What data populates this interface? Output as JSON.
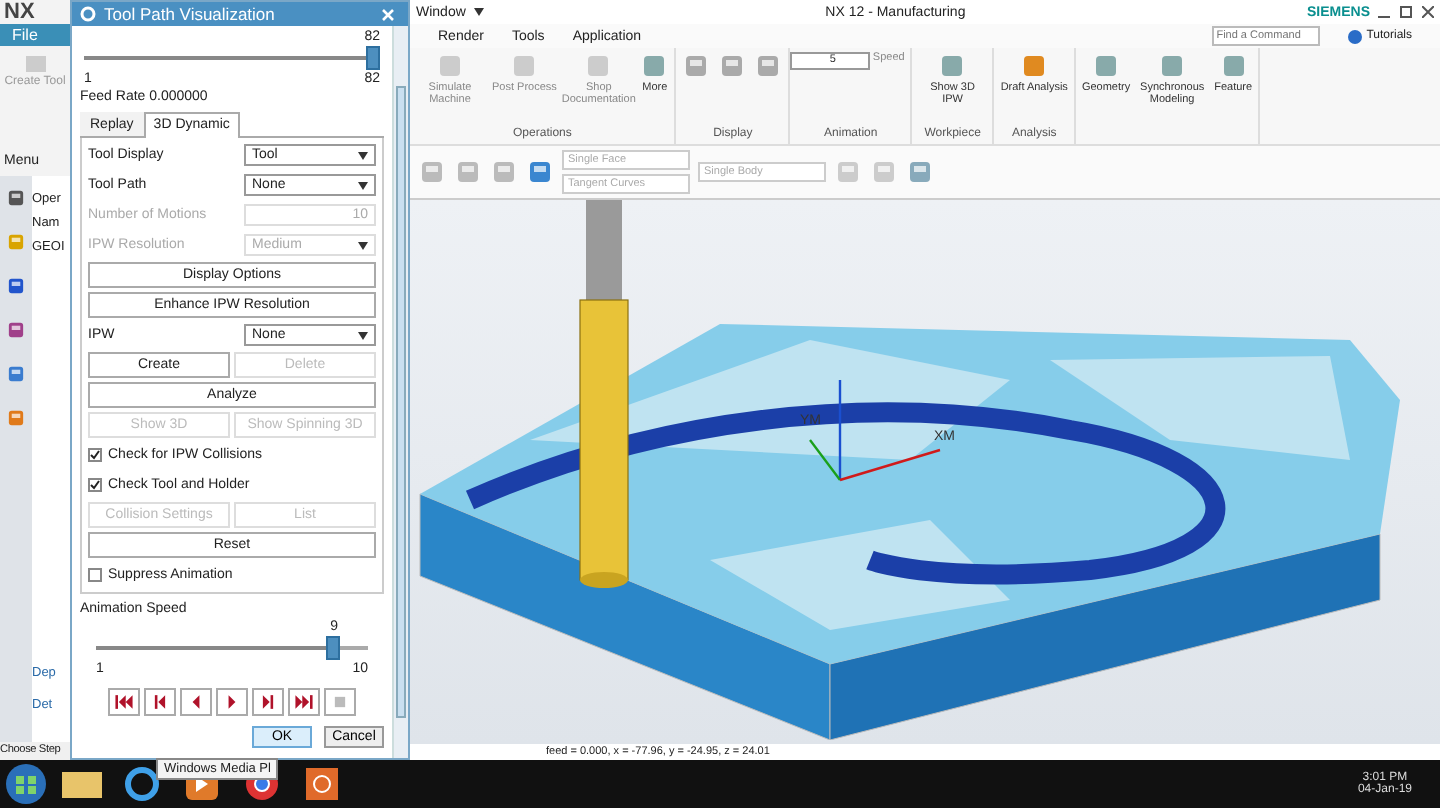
{
  "background_app": {
    "logo": "NX",
    "file_tab": "File",
    "create_button": "Create Tool",
    "menu": "Menu",
    "navigator_header": "Oper",
    "navigator_column": "Nam",
    "navigator_row": "GEOI",
    "detail_rows": [
      "Dep",
      "Det"
    ],
    "status": "Choose Step"
  },
  "main_window": {
    "menu_title": "Window",
    "title": "NX 12 - Manufacturing",
    "brand": "SIEMENS",
    "tabs": [
      {
        "label": "Render"
      },
      {
        "label": "Tools"
      },
      {
        "label": "Application"
      }
    ],
    "search": {
      "placeholder": "Find a Command"
    },
    "help": "Tutorials",
    "ribbon_groups": [
      {
        "label": "Operations",
        "buttons": [
          "Simulate Machine",
          "Post Process",
          "Shop Documentation",
          "More"
        ]
      },
      {
        "label": "Display"
      },
      {
        "label": "Animation",
        "buttons": [
          "Speed"
        ],
        "speed_value": "5"
      },
      {
        "label": "Workpiece",
        "buttons": [
          "Show 3D IPW"
        ]
      },
      {
        "label": "Analysis",
        "buttons": [
          "Draft Analysis"
        ]
      },
      {
        "buttons": [
          "Geometry",
          "Synchronous Modeling",
          "Feature"
        ]
      }
    ],
    "selection_filters": [
      "Single Face",
      "Single Body",
      "Tangent Curves"
    ],
    "viewport": {
      "axis_labels": [
        "YM",
        "XM"
      ]
    },
    "status_bar": "feed = 0.000, x = -77.96, y = -24.95, z = 24.01"
  },
  "dialog": {
    "title": "Tool Path Visualization",
    "motion_slider": {
      "max_label": "82",
      "value": "82",
      "min_label": "1",
      "level": 1
    },
    "feed_rate": "Feed Rate 0.000000",
    "tabs": [
      {
        "label": "Replay",
        "selected": false
      },
      {
        "label": "3D Dynamic",
        "selected": true
      }
    ],
    "rows": [
      {
        "kind": "dropdown",
        "label": "Tool Display",
        "value": "Tool",
        "disabled": false
      },
      {
        "kind": "dropdown",
        "label": "Tool Path",
        "value": "None",
        "disabled": false
      },
      {
        "kind": "field",
        "label": "Number of Motions",
        "value": "10",
        "disabled": true
      },
      {
        "kind": "dropdown",
        "label": "IPW Resolution",
        "value": "Medium",
        "disabled": true
      },
      {
        "kind": "buttons",
        "buttons": [
          {
            "label": "Display Options",
            "disabled": false
          }
        ]
      },
      {
        "kind": "buttons",
        "buttons": [
          {
            "label": "Enhance IPW Resolution",
            "disabled": false
          }
        ]
      },
      {
        "kind": "dropdown",
        "label": "IPW",
        "value": "None",
        "disabled": false
      },
      {
        "kind": "buttons",
        "buttons": [
          {
            "label": "Create",
            "disabled": false
          },
          {
            "label": "Delete",
            "disabled": true
          }
        ]
      },
      {
        "kind": "buttons",
        "buttons": [
          {
            "label": "Analyze",
            "disabled": false
          }
        ]
      },
      {
        "kind": "buttons",
        "buttons": [
          {
            "label": "Show 3D",
            "disabled": true
          },
          {
            "label": "Show Spinning 3D",
            "disabled": true
          }
        ]
      },
      {
        "kind": "checkbox",
        "label": "Check for IPW Collisions",
        "checked": true
      },
      {
        "kind": "checkbox",
        "label": "Check Tool and Holder",
        "checked": true
      },
      {
        "kind": "buttons",
        "buttons": [
          {
            "label": "Collision Settings",
            "disabled": true
          },
          {
            "label": "List",
            "disabled": true
          }
        ]
      },
      {
        "kind": "buttons",
        "buttons": [
          {
            "label": "Reset",
            "disabled": false
          }
        ]
      },
      {
        "kind": "checkbox",
        "label": "Suppress Animation",
        "checked": false
      }
    ],
    "speed": {
      "label": "Animation Speed",
      "value": "9",
      "min_label": "1",
      "max_label": "10",
      "level": 0.89
    },
    "playback": [
      {
        "kind": "first",
        "disabled": false
      },
      {
        "kind": "prev",
        "disabled": false
      },
      {
        "kind": "back",
        "disabled": false
      },
      {
        "kind": "play",
        "disabled": false
      },
      {
        "kind": "next",
        "disabled": false
      },
      {
        "kind": "last",
        "disabled": false
      },
      {
        "kind": "stop",
        "disabled": true
      }
    ],
    "footer_buttons": [
      "OK",
      "Cancel"
    ]
  },
  "tooltip": "Windows Media Pl",
  "taskbar": {
    "time": "3:01 PM",
    "date": "04-Jan-19"
  }
}
